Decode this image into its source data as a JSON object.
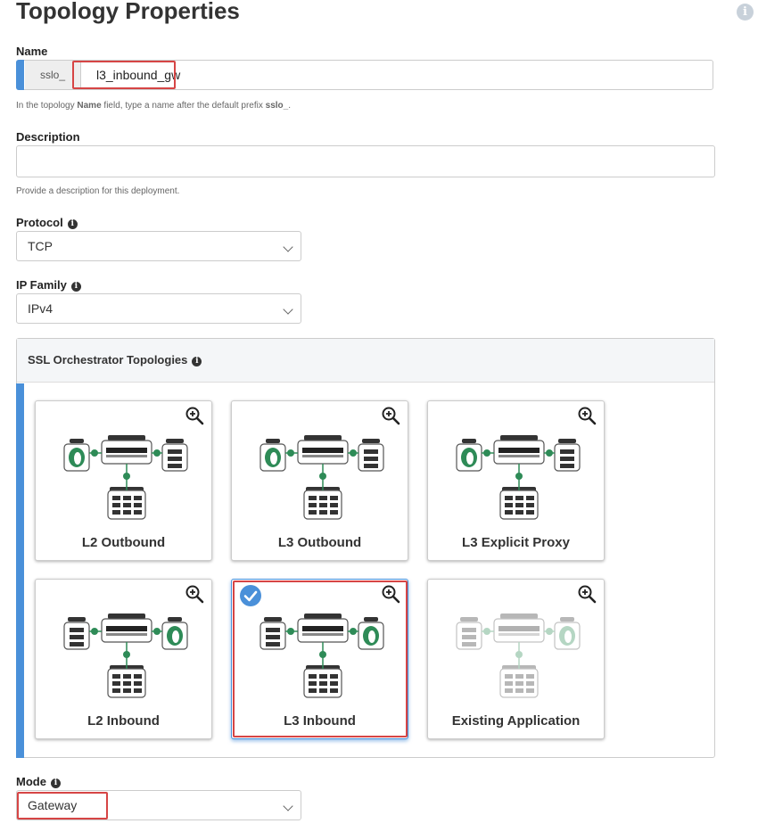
{
  "header": {
    "title": "Topology Properties",
    "help_icon": "info-circle-icon"
  },
  "name_field": {
    "label": "Name",
    "prefix": "sslo_",
    "value": "l3_inbound_gw"
  },
  "name_hint": {
    "before": "In the topology ",
    "bold": "Name",
    "middle": " field, type a name after the default prefix ",
    "prefix_bold": "sslo_",
    "after": "."
  },
  "description": {
    "label": "Description",
    "value": "",
    "hint": "Provide a description for this deployment."
  },
  "protocol": {
    "label": "Protocol",
    "value": "TCP"
  },
  "ip_family": {
    "label": "IP Family",
    "value": "IPv4"
  },
  "topologies": {
    "title": "SSL Orchestrator Topologies",
    "selected": "L3 Inbound",
    "cards": [
      {
        "label": "L2 Outbound",
        "kind": "outbound",
        "faded": false
      },
      {
        "label": "L3 Outbound",
        "kind": "outbound",
        "faded": false
      },
      {
        "label": "L3 Explicit Proxy",
        "kind": "outbound",
        "faded": false
      },
      {
        "label": "L2 Inbound",
        "kind": "inbound",
        "faded": false
      },
      {
        "label": "L3 Inbound",
        "kind": "inbound",
        "faded": false
      },
      {
        "label": "Existing Application",
        "kind": "existing",
        "faded": true
      }
    ]
  },
  "mode": {
    "label": "Mode",
    "value": "Gateway"
  },
  "colors": {
    "accent": "#4a90d9",
    "highlight": "#d64545",
    "node_green": "#2e8b57"
  }
}
